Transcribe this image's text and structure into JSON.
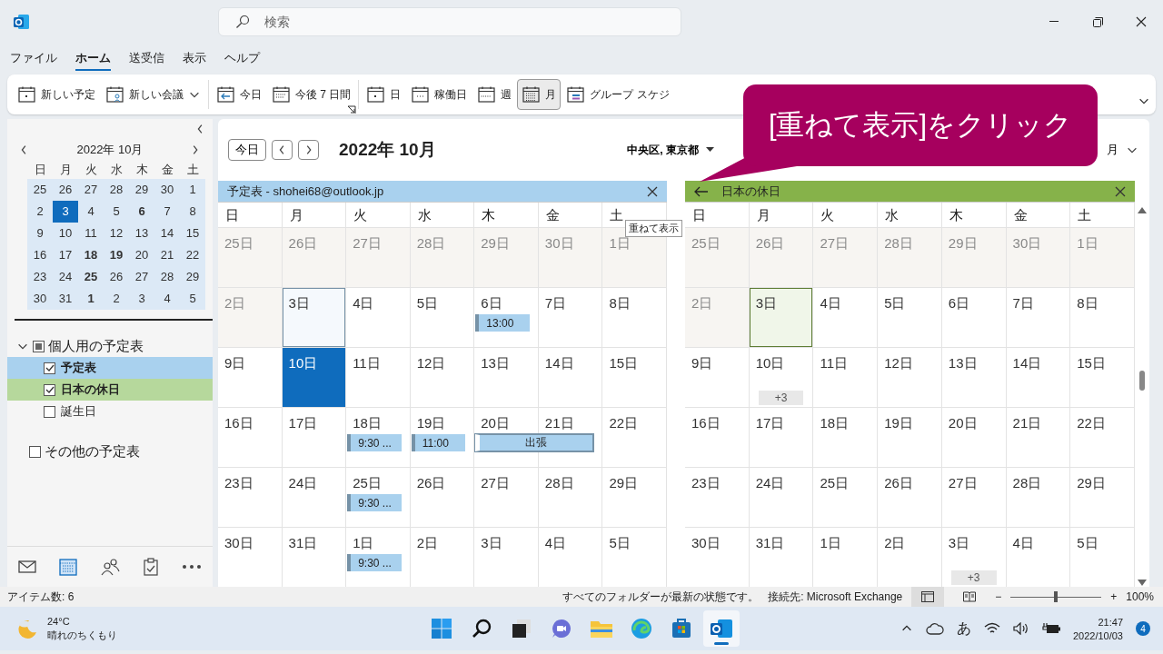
{
  "window": {
    "search": {
      "placeholder": "検索"
    }
  },
  "menu": [
    {
      "label": "ファイル",
      "selected": false
    },
    {
      "label": "ホーム",
      "selected": true
    },
    {
      "label": "送受信",
      "selected": false
    },
    {
      "label": "表示",
      "selected": false
    },
    {
      "label": "ヘルプ",
      "selected": false
    }
  ],
  "ribbon": {
    "groups": [
      {
        "launcher": false,
        "items": [
          {
            "kind": "new-event",
            "label": "新しい予定",
            "selected": false,
            "dropdown": false
          },
          {
            "kind": "new-meeting",
            "label": "新しい会議",
            "selected": false,
            "dropdown": true
          }
        ]
      },
      {
        "launcher": true,
        "items": [
          {
            "kind": "today",
            "label": "今日",
            "selected": false,
            "dropdown": false
          },
          {
            "kind": "next7",
            "label": "今後 7 日間",
            "selected": false,
            "dropdown": false
          }
        ]
      },
      {
        "launcher": false,
        "items": [
          {
            "kind": "day",
            "label": "日",
            "selected": false,
            "dropdown": false
          },
          {
            "kind": "workweek",
            "label": "稼働日",
            "selected": false,
            "dropdown": false
          },
          {
            "kind": "week",
            "label": "週",
            "selected": false,
            "dropdown": false
          },
          {
            "kind": "month",
            "label": "月",
            "selected": true,
            "dropdown": false
          },
          {
            "kind": "group",
            "label": "グループ スケジ",
            "selected": false,
            "dropdown": false
          }
        ]
      }
    ]
  },
  "callout": {
    "text": "[重ねて表示]をクリック"
  },
  "mini_calendar": {
    "title": "2022年 10月",
    "day_names": [
      "日",
      "月",
      "火",
      "水",
      "木",
      "金",
      "土"
    ],
    "weeks": [
      [
        {
          "label": "25",
          "bold": false,
          "selected": false
        },
        {
          "label": "26",
          "bold": false,
          "selected": false
        },
        {
          "label": "27",
          "bold": false,
          "selected": false
        },
        {
          "label": "28",
          "bold": false,
          "selected": false
        },
        {
          "label": "29",
          "bold": false,
          "selected": false
        },
        {
          "label": "30",
          "bold": false,
          "selected": false
        },
        {
          "label": "1",
          "bold": false,
          "selected": false
        }
      ],
      [
        {
          "label": "2",
          "bold": false,
          "selected": false
        },
        {
          "label": "3",
          "bold": false,
          "selected": true
        },
        {
          "label": "4",
          "bold": false,
          "selected": false
        },
        {
          "label": "5",
          "bold": false,
          "selected": false
        },
        {
          "label": "6",
          "bold": true,
          "selected": false
        },
        {
          "label": "7",
          "bold": false,
          "selected": false
        },
        {
          "label": "8",
          "bold": false,
          "selected": false
        }
      ],
      [
        {
          "label": "9",
          "bold": false,
          "selected": false
        },
        {
          "label": "10",
          "bold": false,
          "selected": false
        },
        {
          "label": "11",
          "bold": false,
          "selected": false
        },
        {
          "label": "12",
          "bold": false,
          "selected": false
        },
        {
          "label": "13",
          "bold": false,
          "selected": false
        },
        {
          "label": "14",
          "bold": false,
          "selected": false
        },
        {
          "label": "15",
          "bold": false,
          "selected": false
        }
      ],
      [
        {
          "label": "16",
          "bold": false,
          "selected": false
        },
        {
          "label": "17",
          "bold": false,
          "selected": false
        },
        {
          "label": "18",
          "bold": true,
          "selected": false
        },
        {
          "label": "19",
          "bold": true,
          "selected": false
        },
        {
          "label": "20",
          "bold": false,
          "selected": false
        },
        {
          "label": "21",
          "bold": false,
          "selected": false
        },
        {
          "label": "22",
          "bold": false,
          "selected": false
        }
      ],
      [
        {
          "label": "23",
          "bold": false,
          "selected": false
        },
        {
          "label": "24",
          "bold": false,
          "selected": false
        },
        {
          "label": "25",
          "bold": true,
          "selected": false
        },
        {
          "label": "26",
          "bold": false,
          "selected": false
        },
        {
          "label": "27",
          "bold": false,
          "selected": false
        },
        {
          "label": "28",
          "bold": false,
          "selected": false
        },
        {
          "label": "29",
          "bold": false,
          "selected": false
        }
      ],
      [
        {
          "label": "30",
          "bold": false,
          "selected": false
        },
        {
          "label": "31",
          "bold": false,
          "selected": false
        },
        {
          "label": "1",
          "bold": true,
          "selected": false
        },
        {
          "label": "2",
          "bold": false,
          "selected": false
        },
        {
          "label": "3",
          "bold": false,
          "selected": false
        },
        {
          "label": "4",
          "bold": false,
          "selected": false
        },
        {
          "label": "5",
          "bold": false,
          "selected": false
        }
      ]
    ]
  },
  "calendars": [
    {
      "label": "個人用の予定表",
      "expanded": true,
      "indeterminate": true,
      "children": [
        {
          "label": "予定表",
          "checked": true,
          "color": "#a9d1ee"
        },
        {
          "label": "日本の休日",
          "checked": true,
          "color": "#b6d89c"
        },
        {
          "label": "誕生日",
          "checked": false
        }
      ]
    },
    {
      "label": "その他の予定表",
      "indeterminate": false,
      "checked": false
    }
  ],
  "nav": [
    {
      "kind": "mail",
      "selected": false
    },
    {
      "kind": "calendar",
      "selected": true
    },
    {
      "kind": "people",
      "selected": false
    },
    {
      "kind": "tasks",
      "selected": false
    },
    {
      "kind": "more",
      "selected": false
    }
  ],
  "view_header": {
    "today_button": "今日",
    "title": "2022年 10月",
    "location": "中央区, 東京都",
    "view": "月"
  },
  "tooltip": "重ねて表示",
  "panes": [
    {
      "title": "予定表 - shohei68@outlook.jp",
      "color": "#a9d1ee",
      "overlay_arrow": false,
      "day_names": [
        "日",
        "月",
        "火",
        "水",
        "木",
        "金",
        "土"
      ],
      "weeks": [
        [
          {
            "label": "25日",
            "past": true,
            "today": false,
            "selected": false
          },
          {
            "label": "26日",
            "past": true,
            "today": false,
            "selected": false
          },
          {
            "label": "27日",
            "past": true,
            "today": false,
            "selected": false
          },
          {
            "label": "28日",
            "past": true,
            "today": false,
            "selected": false
          },
          {
            "label": "29日",
            "past": true,
            "today": false,
            "selected": false
          },
          {
            "label": "30日",
            "past": true,
            "today": false,
            "selected": false
          },
          {
            "label": "1日",
            "past": true,
            "today": false,
            "selected": false
          }
        ],
        [
          {
            "label": "2日",
            "past": true,
            "today": false,
            "selected": false
          },
          {
            "label": "3日",
            "past": false,
            "today": true,
            "selected": false
          },
          {
            "label": "4日",
            "past": false,
            "today": false,
            "selected": false
          },
          {
            "label": "5日",
            "past": false,
            "today": false,
            "selected": false
          },
          {
            "label": "6日",
            "past": false,
            "today": false,
            "selected": false,
            "events": [
              {
                "label": "13:00",
                "kind": "timed"
              }
            ]
          },
          {
            "label": "7日",
            "past": false,
            "today": false,
            "selected": false
          },
          {
            "label": "8日",
            "past": false,
            "today": false,
            "selected": false
          }
        ],
        [
          {
            "label": "9日",
            "past": false,
            "today": false,
            "selected": false
          },
          {
            "label": "10日",
            "past": false,
            "today": false,
            "selected": true
          },
          {
            "label": "11日",
            "past": false,
            "today": false,
            "selected": false
          },
          {
            "label": "12日",
            "past": false,
            "today": false,
            "selected": false
          },
          {
            "label": "13日",
            "past": false,
            "today": false,
            "selected": false
          },
          {
            "label": "14日",
            "past": false,
            "today": false,
            "selected": false
          },
          {
            "label": "15日",
            "past": false,
            "today": false,
            "selected": false
          }
        ],
        [
          {
            "label": "16日",
            "past": false,
            "today": false,
            "selected": false
          },
          {
            "label": "17日",
            "past": false,
            "today": false,
            "selected": false
          },
          {
            "label": "18日",
            "past": false,
            "today": false,
            "selected": false,
            "events": [
              {
                "label": "9:30 ...",
                "kind": "timed"
              }
            ]
          },
          {
            "label": "19日",
            "past": false,
            "today": false,
            "selected": false,
            "events": [
              {
                "label": "11:00",
                "kind": "timed"
              }
            ]
          },
          {
            "label": "20日",
            "past": false,
            "today": false,
            "selected": false,
            "events": [
              {
                "label": "出張",
                "kind": "two-day"
              }
            ]
          },
          {
            "label": "21日",
            "past": false,
            "today": false,
            "selected": false
          },
          {
            "label": "22日",
            "past": false,
            "today": false,
            "selected": false
          }
        ],
        [
          {
            "label": "23日",
            "past": false,
            "today": false,
            "selected": false
          },
          {
            "label": "24日",
            "past": false,
            "today": false,
            "selected": false
          },
          {
            "label": "25日",
            "past": false,
            "today": false,
            "selected": false,
            "events": [
              {
                "label": "9:30 ...",
                "kind": "timed"
              }
            ]
          },
          {
            "label": "26日",
            "past": false,
            "today": false,
            "selected": false
          },
          {
            "label": "27日",
            "past": false,
            "today": false,
            "selected": false
          },
          {
            "label": "28日",
            "past": false,
            "today": false,
            "selected": false
          },
          {
            "label": "29日",
            "past": false,
            "today": false,
            "selected": false
          }
        ],
        [
          {
            "label": "30日",
            "past": false,
            "today": false,
            "selected": false
          },
          {
            "label": "31日",
            "past": false,
            "today": false,
            "selected": false
          },
          {
            "label": "1日",
            "past": false,
            "today": false,
            "selected": false,
            "events": [
              {
                "label": "9:30 ...",
                "kind": "timed"
              }
            ]
          },
          {
            "label": "2日",
            "past": false,
            "today": false,
            "selected": false
          },
          {
            "label": "3日",
            "past": false,
            "today": false,
            "selected": false
          },
          {
            "label": "4日",
            "past": false,
            "today": false,
            "selected": false
          },
          {
            "label": "5日",
            "past": false,
            "today": false,
            "selected": false
          }
        ]
      ]
    },
    {
      "title": "日本の休日",
      "color": "#86b24a",
      "overlay_arrow": true,
      "day_names": [
        "日",
        "月",
        "火",
        "水",
        "木",
        "金",
        "土"
      ],
      "weeks": [
        [
          {
            "label": "25日",
            "past": true,
            "today": false,
            "selected": false
          },
          {
            "label": "26日",
            "past": true,
            "today": false,
            "selected": false
          },
          {
            "label": "27日",
            "past": true,
            "today": false,
            "selected": false
          },
          {
            "label": "28日",
            "past": true,
            "today": false,
            "selected": false
          },
          {
            "label": "29日",
            "past": true,
            "today": false,
            "selected": false
          },
          {
            "label": "30日",
            "past": true,
            "today": false,
            "selected": false
          },
          {
            "label": "1日",
            "past": true,
            "today": false,
            "selected": false
          }
        ],
        [
          {
            "label": "2日",
            "past": true,
            "today": false,
            "selected": false
          },
          {
            "label": "3日",
            "past": false,
            "today": true,
            "selected": false
          },
          {
            "label": "4日",
            "past": false,
            "today": false,
            "selected": false
          },
          {
            "label": "5日",
            "past": false,
            "today": false,
            "selected": false
          },
          {
            "label": "6日",
            "past": false,
            "today": false,
            "selected": false
          },
          {
            "label": "7日",
            "past": false,
            "today": false,
            "selected": false
          },
          {
            "label": "8日",
            "past": false,
            "today": false,
            "selected": false
          }
        ],
        [
          {
            "label": "9日",
            "past": false,
            "today": false,
            "selected": false
          },
          {
            "label": "10日",
            "past": false,
            "today": false,
            "selected": false,
            "more": "+3"
          },
          {
            "label": "11日",
            "past": false,
            "today": false,
            "selected": false
          },
          {
            "label": "12日",
            "past": false,
            "today": false,
            "selected": false
          },
          {
            "label": "13日",
            "past": false,
            "today": false,
            "selected": false
          },
          {
            "label": "14日",
            "past": false,
            "today": false,
            "selected": false
          },
          {
            "label": "15日",
            "past": false,
            "today": false,
            "selected": false
          }
        ],
        [
          {
            "label": "16日",
            "past": false,
            "today": false,
            "selected": false
          },
          {
            "label": "17日",
            "past": false,
            "today": false,
            "selected": false
          },
          {
            "label": "18日",
            "past": false,
            "today": false,
            "selected": false
          },
          {
            "label": "19日",
            "past": false,
            "today": false,
            "selected": false
          },
          {
            "label": "20日",
            "past": false,
            "today": false,
            "selected": false
          },
          {
            "label": "21日",
            "past": false,
            "today": false,
            "selected": false
          },
          {
            "label": "22日",
            "past": false,
            "today": false,
            "selected": false
          }
        ],
        [
          {
            "label": "23日",
            "past": false,
            "today": false,
            "selected": false
          },
          {
            "label": "24日",
            "past": false,
            "today": false,
            "selected": false
          },
          {
            "label": "25日",
            "past": false,
            "today": false,
            "selected": false
          },
          {
            "label": "26日",
            "past": false,
            "today": false,
            "selected": false
          },
          {
            "label": "27日",
            "past": false,
            "today": false,
            "selected": false
          },
          {
            "label": "28日",
            "past": false,
            "today": false,
            "selected": false
          },
          {
            "label": "29日",
            "past": false,
            "today": false,
            "selected": false
          }
        ],
        [
          {
            "label": "30日",
            "past": false,
            "today": false,
            "selected": false
          },
          {
            "label": "31日",
            "past": false,
            "today": false,
            "selected": false
          },
          {
            "label": "1日",
            "past": false,
            "today": false,
            "selected": false
          },
          {
            "label": "2日",
            "past": false,
            "today": false,
            "selected": false
          },
          {
            "label": "3日",
            "past": false,
            "today": false,
            "selected": false,
            "more": "+3"
          },
          {
            "label": "4日",
            "past": false,
            "today": false,
            "selected": false
          },
          {
            "label": "5日",
            "past": false,
            "today": false,
            "selected": false
          }
        ]
      ]
    }
  ],
  "status_bar": {
    "items_count": "アイテム数: 6",
    "sync": "すべてのフォルダーが最新の状態です。",
    "connection": "接続先: Microsoft Exchange",
    "views": [
      {
        "kind": "normal",
        "selected": true
      },
      {
        "kind": "reading",
        "selected": false
      }
    ],
    "zoom_out": "−",
    "zoom": {
      "level": 0.5
    },
    "zoom_in": "+",
    "zoom_label": "100%"
  },
  "taskbar": {
    "weather": {
      "temp": "24°C",
      "condition": "晴れのちくもり"
    },
    "apps": [
      {
        "kind": "start",
        "active": false
      },
      {
        "kind": "search",
        "active": false
      },
      {
        "kind": "task-view",
        "active": false
      },
      {
        "kind": "chat",
        "active": false
      },
      {
        "kind": "folder",
        "active": false
      },
      {
        "kind": "browser",
        "active": false
      },
      {
        "kind": "store",
        "active": false
      },
      {
        "kind": "mail-app",
        "active": true
      }
    ],
    "tray": {
      "ime": "あ",
      "time": "21:47",
      "date": "2022/10/03",
      "notifications": "4"
    }
  }
}
